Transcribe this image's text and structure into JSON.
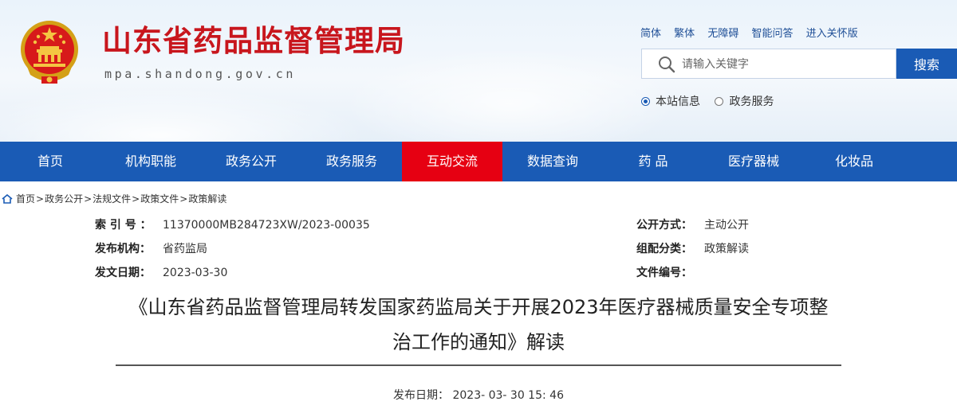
{
  "header": {
    "site_title": "山东省药品监督管理局",
    "site_domain": "mpa.shandong.gov.cn",
    "top_links": [
      "简体",
      "繁体",
      "无障碍",
      "智能问答",
      "进入关怀版"
    ]
  },
  "search": {
    "placeholder": "请输入关键字",
    "button_label": "搜索",
    "scope_options": [
      "本站信息",
      "政务服务"
    ],
    "selected_scope": "本站信息"
  },
  "nav": {
    "items": [
      "首页",
      "机构职能",
      "政务公开",
      "政务服务",
      "互动交流",
      "数据查询",
      "药 品",
      "医疗器械",
      "化妆品"
    ],
    "active": "互动交流"
  },
  "breadcrumb": [
    "首页",
    "政务公开",
    "法规文件",
    "政策文件",
    "政策解读"
  ],
  "meta": {
    "index_label": "索 引 号 ：",
    "index_value": "11370000MB284723XW/2023-00035",
    "publisher_label": "发布机构：",
    "publisher_value": "省药监局",
    "date_label": "发文日期：",
    "date_value": "2023-03-30",
    "open_mode_label": "公开方式：",
    "open_mode_value": "主动公开",
    "category_label": "组配分类：",
    "category_value": "政策解读",
    "doc_no_label": "文件编号：",
    "doc_no_value": ""
  },
  "article": {
    "title_line1": "《山东省药品监督管理局转发国家药监局关于开展2023年医疗器械质量安全专项整",
    "title_line2": "治工作的通知》解读",
    "pubdate_label": "发布日期：",
    "pubdate_value": "2023- 03- 30 15: 46"
  },
  "colors": {
    "brand_red": "#c8161d",
    "nav_blue": "#1a5bb5",
    "nav_active": "#e60012"
  }
}
